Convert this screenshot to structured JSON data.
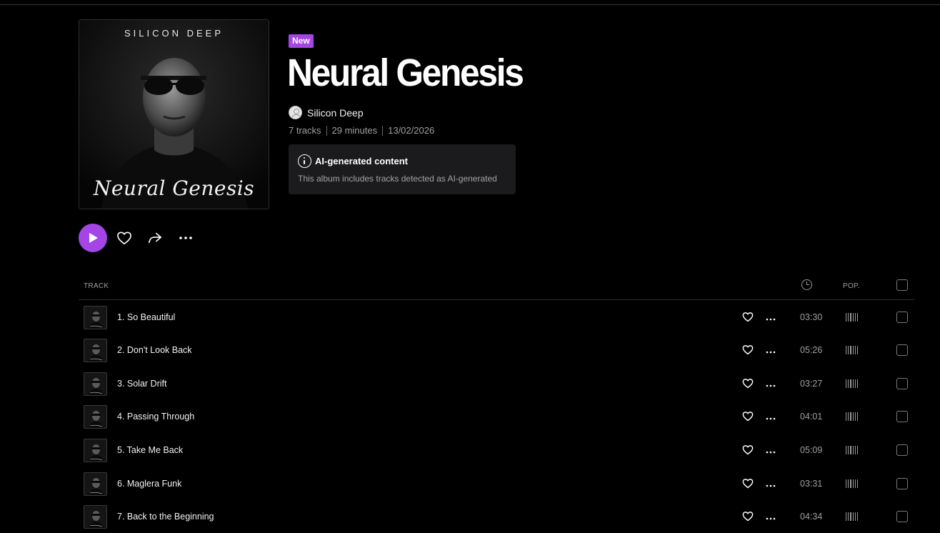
{
  "album": {
    "badge": "New",
    "title": "Neural Genesis",
    "artist": "Silicon Deep",
    "track_count": "7 tracks",
    "duration": "29 minutes",
    "release_date": "13/02/2026",
    "cover": {
      "artist_text": "SILICON DEEP",
      "title_text": "Neural Genesis"
    }
  },
  "ai_notice": {
    "title": "AI-generated content",
    "description": "This album includes tracks detected as AI-generated"
  },
  "actions": {
    "play": "play-icon",
    "like": "heart-icon",
    "share": "share-icon",
    "more": "more-icon"
  },
  "table": {
    "header_track": "TRACK",
    "header_pop": "POP.",
    "header_duration_icon": "clock-icon"
  },
  "tracks": [
    {
      "name": "1. So Beautiful",
      "duration": "03:30"
    },
    {
      "name": "2. Don't Look Back",
      "duration": "05:26"
    },
    {
      "name": "3. Solar Drift",
      "duration": "03:27"
    },
    {
      "name": "4. Passing Through",
      "duration": "04:01"
    },
    {
      "name": "5. Take Me Back",
      "duration": "05:09"
    },
    {
      "name": "6. Maglera Funk",
      "duration": "03:31"
    },
    {
      "name": "7. Back to the Beginning",
      "duration": "04:34"
    }
  ],
  "colors": {
    "accent": "#a445e6",
    "background": "#000000",
    "notice_bg": "#1b1b1d",
    "muted_text": "#a0a0a0"
  }
}
